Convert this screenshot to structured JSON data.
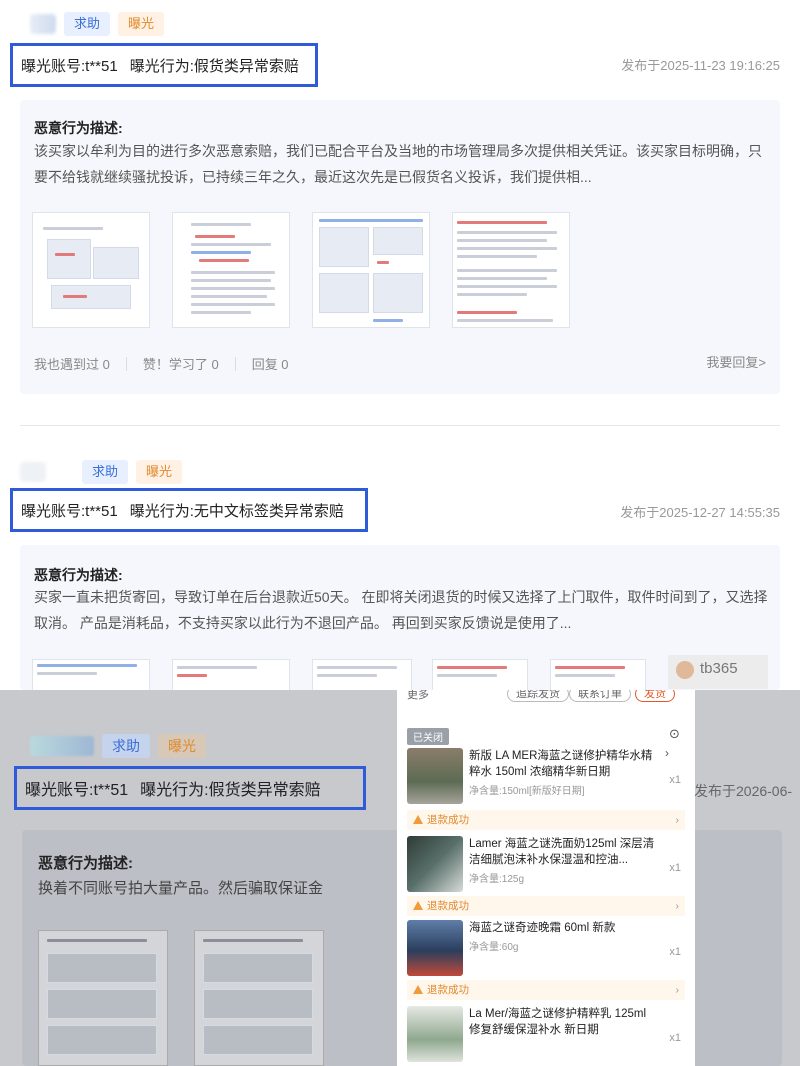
{
  "tags": {
    "help": "求助",
    "expose": "曝光"
  },
  "post1": {
    "account_label": "曝光账号:t**51",
    "behavior_label": "曝光行为:假货类异常索赔",
    "date": "发布于2025-11-23 19:16:25",
    "desc_title": "恶意行为描述:",
    "desc_text": "该买家以牟利为目的进行多次恶意索赔，我们已配合平台及当地的市场管理局多次提供相关凭证。该买家目标明确，只要不给钱就继续骚扰投诉，已持续三年之久，最近这次先是已假货名义投诉，我们提供相...",
    "actions": {
      "met": "我也遇到过 0",
      "like": "赞！学习了 0",
      "reply": "回复 0",
      "reply_link": "我要回复>"
    }
  },
  "post2": {
    "account_label": "曝光账号:t**51",
    "behavior_label": "曝光行为:无中文标签类异常索赔",
    "date": "发布于2025-12-27 14:55:35",
    "desc_title": "恶意行为描述:",
    "desc_text": "买家一直未把货寄回，导致订单在后台退款近50天。 在即将关闭退货的时候又选择了上门取件，取件时间到了，又选择取消。 产品是消耗品，不支持买家以此行为不退回产品。 再回到买家反馈说是使用了...",
    "watermark": "tb365"
  },
  "post3": {
    "account_label": "曝光账号:t**51",
    "behavior_label": "曝光行为:假货类异常索赔",
    "date": "发布于2026-06-",
    "desc_title": "恶意行为描述:",
    "desc_text": "换着不同账号拍大量产品。然后骗取保证金"
  },
  "phone": {
    "top_left": "更多",
    "btn_logistics": "opt-logistics",
    "btn1": "追踪发货",
    "btn2": "联系订单",
    "btn3": "发货",
    "closed": "已关闭",
    "items": [
      {
        "name": "新版 LA MER海蓝之谜修护精华水精粹水 150ml 浓缩精华新日期",
        "spec": "净含量:150ml[新版好日期]",
        "qty": "x1",
        "refund": "退款成功"
      },
      {
        "name": "Lamer 海蓝之谜洗面奶125ml 深层清洁细腻泡沫补水保湿温和控油...",
        "spec": "净含量:125g",
        "qty": "x1",
        "refund": "退款成功"
      },
      {
        "name": "海蓝之谜奇迹晚霜 60ml 新款",
        "spec": "净含量:60g",
        "qty": "x1",
        "refund": "退款成功"
      },
      {
        "name": "La Mer/海蓝之谜修护精粹乳 125ml 修复舒缓保湿补水 新日期",
        "spec": "",
        "qty": "x1",
        "refund": ""
      }
    ]
  },
  "colors": {
    "highlight_border": "#2f5bd9",
    "tag_help": "#3a6fd8",
    "tag_expose": "#e08a2e"
  },
  "icons": [
    "chevron-right-icon",
    "warning-icon",
    "collapse-icon"
  ]
}
